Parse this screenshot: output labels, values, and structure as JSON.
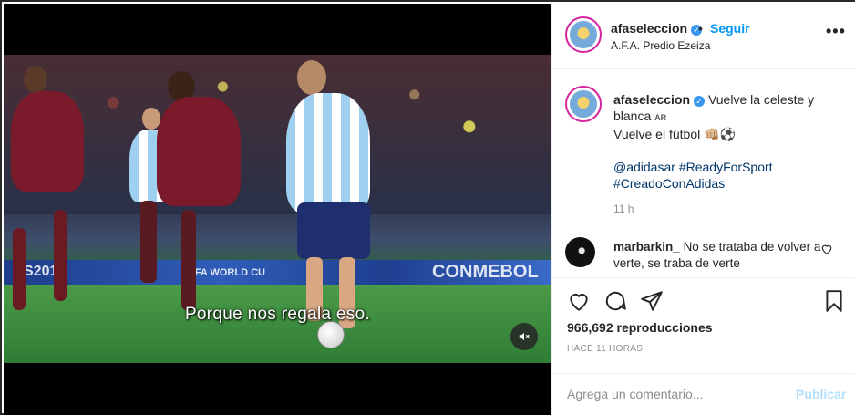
{
  "video": {
    "subtitle": "Porque nos regala eso.",
    "board_text_left": "S201",
    "board_text_mid": "FIFA WORLD CU",
    "board_text_right": "CONMEBOL",
    "mute_icon": "mute-icon"
  },
  "header": {
    "username": "afaseleccion",
    "separator": "•",
    "follow_label": "Seguir",
    "location": "A.F.A. Predio Ezeiza",
    "more_icon": "•••"
  },
  "caption": {
    "username": "afaseleccion",
    "line1": "Vuelve la celeste y blanca",
    "flag": "AR",
    "line2": "Vuelve el fútbol 👊🏼⚽",
    "mention": "@adidasar",
    "hashtag1": "#ReadyForSport",
    "hashtag2": "#CreadoConAdidas",
    "time": "11 h"
  },
  "comment": {
    "username": "marbarkin_",
    "text": "No se trataba de volver a verte, se traba de verte"
  },
  "stats": {
    "views": "966,692 reproducciones",
    "ago": "HACE 11 HORAS"
  },
  "add_comment": {
    "placeholder": "Agrega un comentario...",
    "publish_label": "Publicar"
  },
  "colors": {
    "accent": "#0095f6",
    "verified": "#3897f0",
    "publish_disabled": "#b2dffc"
  }
}
